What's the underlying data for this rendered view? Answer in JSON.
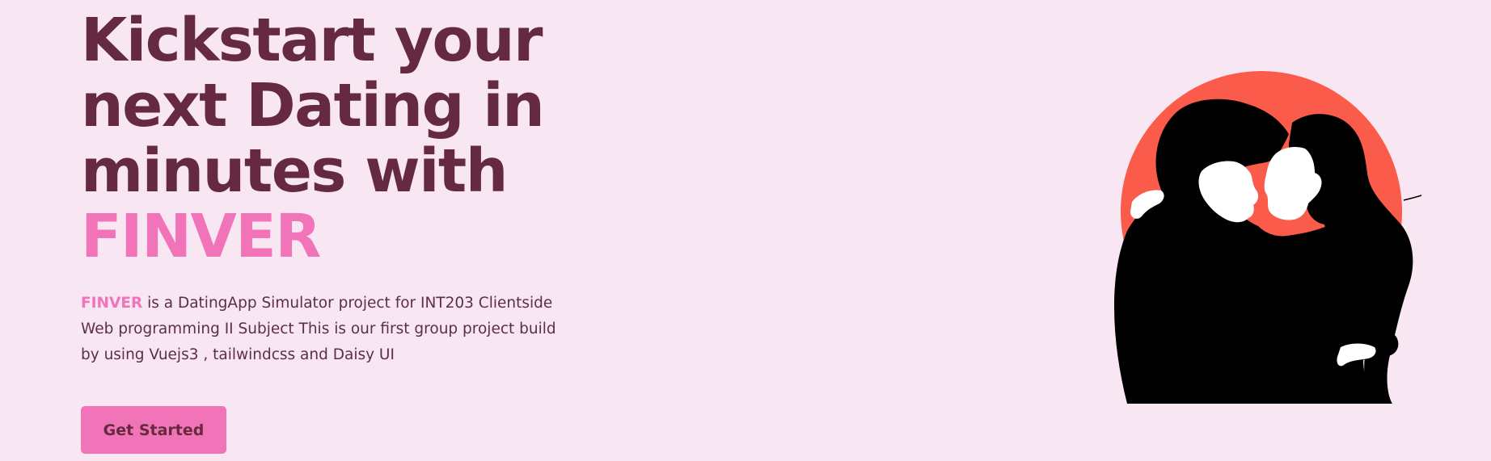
{
  "hero": {
    "headline_line1": "Kickstart your",
    "headline_line2": "next Dating in",
    "headline_line3": "minutes with",
    "headline_brand": "FINVER",
    "description_brand": "FINVER",
    "description_text": " is a DatingApp Simulator project for INT203 Clientside Web programming II Subject This is our first group project build by using Vuejs3 , tailwindcss and Daisy UI",
    "cta_label": "Get Started",
    "illustration_icon": "couple-illustration-icon"
  },
  "colors": {
    "background": "#f9e6f3",
    "heading": "#652a3f",
    "brand_pink": "#f274b8",
    "sun_red": "#fa5b4a"
  }
}
